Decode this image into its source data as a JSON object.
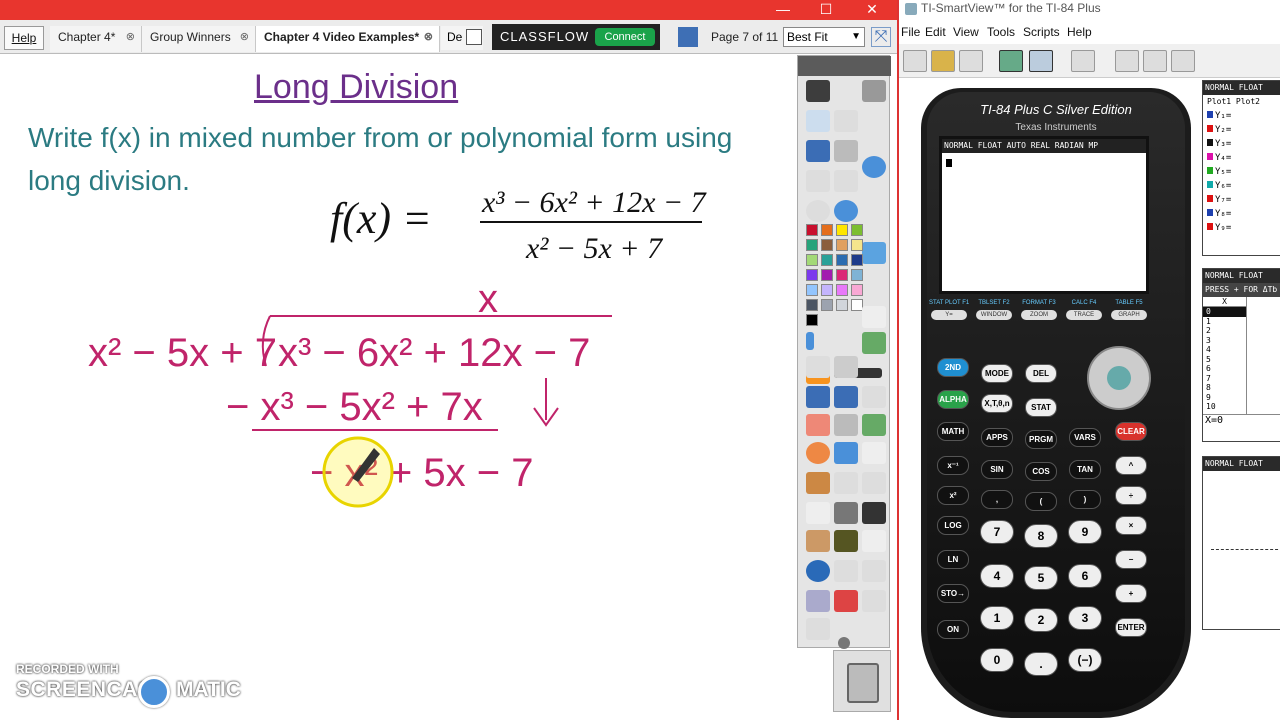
{
  "window": {
    "minimize": "—",
    "maximize": "☐",
    "close": "✕"
  },
  "tabs": {
    "help": "Help",
    "items": [
      {
        "label": "Chapter 4*"
      },
      {
        "label": "Group Winners"
      },
      {
        "label": "Chapter 4 Video Examples*"
      },
      {
        "label": "De"
      }
    ],
    "close_glyph": "⊗"
  },
  "toolbar": {
    "brand": "CLASSFLOW",
    "connect": "Connect",
    "page_label": "Page 7 of 11",
    "zoom": "Best Fit"
  },
  "page": {
    "title": "Long Division",
    "instruction": "Write f(x) in mixed number from or polynomial form using long division.",
    "function_lhs": "f(x) =",
    "numerator": "x³ − 6x² + 12x − 7",
    "denominator": "x² − 5x + 7"
  },
  "handwriting": {
    "quotient": "x",
    "divisor": "x² − 5x + 7",
    "dividend": "x³ − 6x² + 12x − 7",
    "subtract_row": "− x³ − 5x² + 7x",
    "remainder_row": "− x² + 5x − 7",
    "ink_color": "#c0246a"
  },
  "watermark": {
    "line1": "RECORDED WITH",
    "line2": "SCREENCAST",
    "line3": "MATIC"
  },
  "palette_swatches": [
    "#c8102e",
    "#e46e1c",
    "#ffe600",
    "#7cbe31",
    "#26a37a",
    "#8b5e3c",
    "#e0a060",
    "#f4e58c",
    "#a3d977",
    "#2aa198",
    "#2b6cb0",
    "#1e3a8a",
    "#7c3aed",
    "#a21caf",
    "#db2777",
    "#7fb3d5",
    "#93c5fd",
    "#c4b5fd",
    "#e879f9",
    "#f9a8d4",
    "#4b5563",
    "#9ca3af",
    "#d1d5db",
    "#ffffff",
    "#000000"
  ],
  "smartview": {
    "title": "TI-SmartView™ for the TI-84 Plus",
    "menu": [
      "File",
      "Edit",
      "View",
      "Tools",
      "Scripts",
      "Help"
    ],
    "calc_model": "TI-84 Plus C Silver Edition",
    "calc_brand": "Texas Instruments",
    "status_bar": "NORMAL FLOAT AUTO REAL RADIAN MP",
    "fkeys": [
      "Y=",
      "WINDOW",
      "ZOOM",
      "TRACE",
      "GRAPH"
    ],
    "fkey_labels": [
      "STAT PLOT F1",
      "TBLSET F2",
      "FORMAT F3",
      "CALC F4",
      "TABLE F5"
    ],
    "keys": {
      "second": "2ND",
      "mode": "MODE",
      "del": "DEL",
      "alpha": "ALPHA",
      "xton": "X,T,θ,n",
      "stat": "STAT",
      "math": "MATH",
      "apps": "APPS",
      "prgm": "PRGM",
      "vars": "VARS",
      "clear": "CLEAR",
      "inv": "x⁻¹",
      "sin": "SIN",
      "cos": "COS",
      "tan": "TAN",
      "pow": "^",
      "sq": "x²",
      "comma": ",",
      "lp": "(",
      "rp": ")",
      "div": "÷",
      "log": "LOG",
      "n7": "7",
      "n8": "8",
      "n9": "9",
      "mul": "×",
      "ln": "LN",
      "n4": "4",
      "n5": "5",
      "n6": "6",
      "sub": "−",
      "sto": "STO→",
      "n1": "1",
      "n2": "2",
      "n3": "3",
      "add": "+",
      "on": "ON",
      "n0": "0",
      "dot": ".",
      "neg": "(−)",
      "enter": "ENTER"
    },
    "panel_y": {
      "header": "NORMAL FLOAT",
      "plots": "Plot1  Plot2",
      "rows": [
        "Y₁=",
        "Y₂=",
        "Y₃=",
        "Y₄=",
        "Y₅=",
        "Y₆=",
        "Y₇=",
        "Y₈=",
        "Y₉="
      ],
      "colors": [
        "#1e40af",
        "#d11",
        "#111",
        "#d1a",
        "#2a2",
        "#1aa",
        "#d11",
        "#1e40af",
        "#d11"
      ]
    },
    "panel_table": {
      "header1": "NORMAL FLOAT",
      "header2": "PRESS + FOR ΔTb",
      "col": "X",
      "values": [
        "0",
        "1",
        "2",
        "3",
        "4",
        "5",
        "6",
        "7",
        "8",
        "9",
        "10"
      ],
      "footer": "X=0"
    },
    "panel_graph": {
      "header": "NORMAL FLOAT"
    }
  }
}
